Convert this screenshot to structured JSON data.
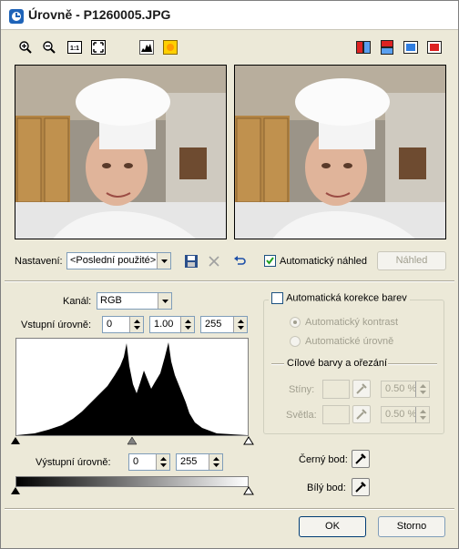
{
  "window": {
    "title": "Úrovně - P1260005.JPG"
  },
  "toolbar": {
    "left_icons": [
      "zoom-in-icon",
      "zoom-out-icon",
      "actual-size-icon",
      "fit-to-window-icon",
      "histogram-icon",
      "auto-color-icon"
    ],
    "right_icons": [
      "split-vertical-icon",
      "split-horizontal-icon",
      "before-view-icon",
      "after-view-icon"
    ]
  },
  "settings": {
    "label": "Nastavení:",
    "selected": "<Poslední použité>",
    "auto_preview_label": "Automatický náhled",
    "auto_preview_checked": true,
    "preview_button": "Náhled"
  },
  "channel": {
    "label": "Kanál:",
    "selected": "RGB"
  },
  "input_levels": {
    "label": "Vstupní úrovně:",
    "black": "0",
    "gamma": "1.00",
    "white": "255"
  },
  "output_levels": {
    "label": "Výstupní úrovně:",
    "black": "0",
    "white": "255"
  },
  "auto_color": {
    "label": "Automatická korekce barev",
    "checked": false,
    "options": [
      {
        "label": "Automatický kontrast",
        "selected": true
      },
      {
        "label": "Automatické úrovně",
        "selected": false
      }
    ],
    "target_group_label": "Cílové barvy a ořezání",
    "shadows_label": "Stíny:",
    "shadows_value": "0.50 %",
    "highlights_label": "Světla:",
    "highlights_value": "0.50 %"
  },
  "black_point_label": "Černý bod:",
  "white_point_label": "Bílý bod:",
  "buttons": {
    "ok": "OK",
    "cancel": "Storno"
  },
  "colors": {
    "dialog_bg": "#ece9d8",
    "title_bg": "#ffffff",
    "histogram_fill": "#000000",
    "disabled_text": "#a19f8f"
  }
}
